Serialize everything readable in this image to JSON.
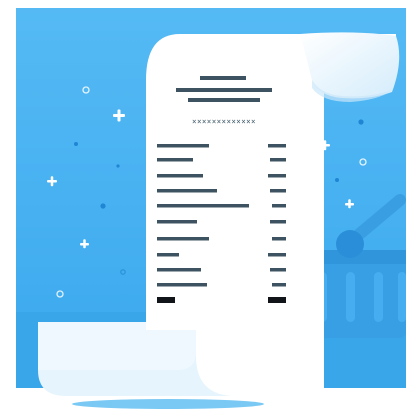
{
  "receipt": {
    "code": "×××××××××××××"
  },
  "colors": {
    "background": "#4ab3f2",
    "background_deep": "#2d9be3",
    "paper": "#ffffff",
    "paper_shade": "#dff1fd",
    "ink": "#3e5361",
    "ink_bold": "#111418",
    "sparkle": "#ffffff",
    "dot": "#1f86d4"
  },
  "icons": {
    "receipt": "receipt-icon",
    "basket": "shopping-basket-icon",
    "sparkle": "plus-sparkle-icon"
  }
}
